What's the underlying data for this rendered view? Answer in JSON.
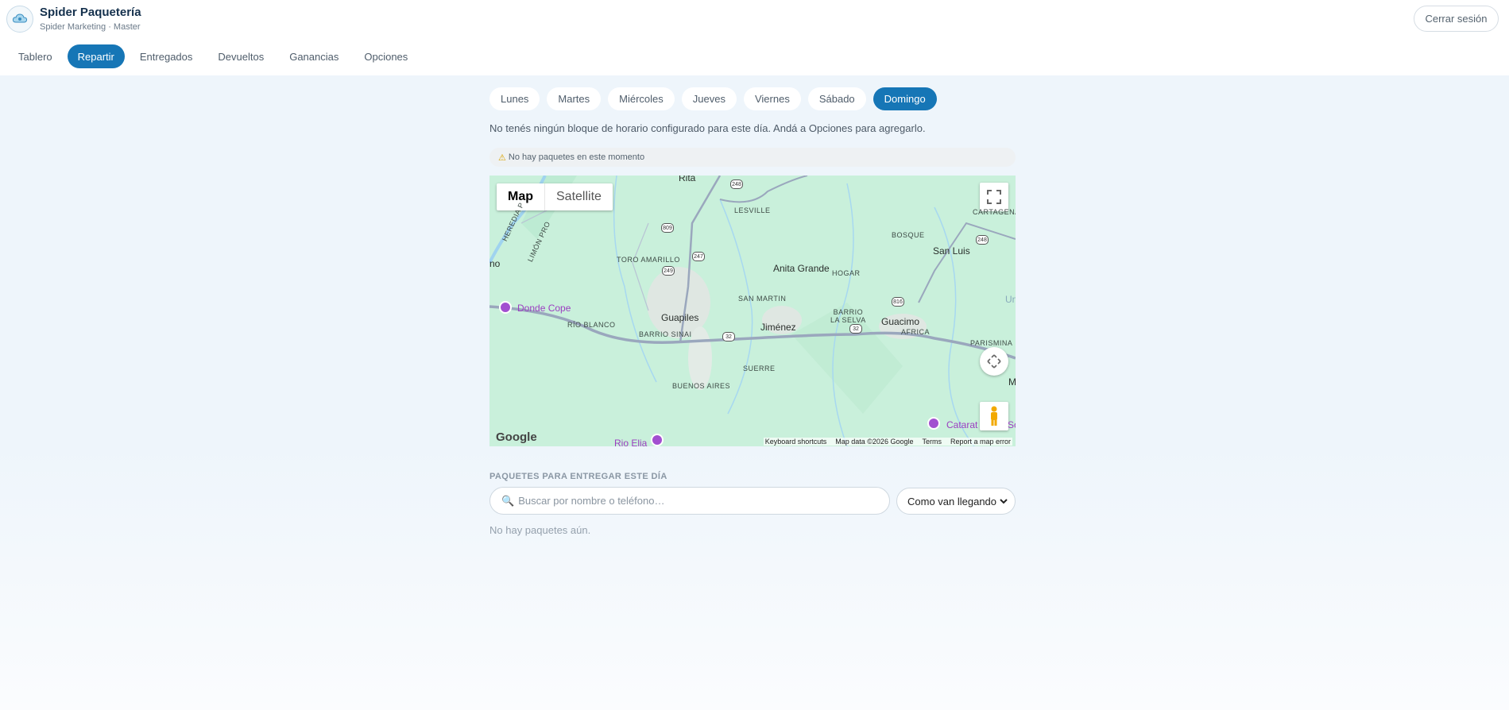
{
  "brand": {
    "title": "Spider Paquetería",
    "subtitle": "Spider Marketing · Master"
  },
  "header": {
    "logout_label": "Cerrar sesión"
  },
  "nav": {
    "items": [
      {
        "label": "Tablero",
        "active": false
      },
      {
        "label": "Repartir",
        "active": true
      },
      {
        "label": "Entregados",
        "active": false
      },
      {
        "label": "Devueltos",
        "active": false
      },
      {
        "label": "Ganancias",
        "active": false
      },
      {
        "label": "Opciones",
        "active": false
      }
    ]
  },
  "days": {
    "items": [
      {
        "label": "Lunes",
        "active": false
      },
      {
        "label": "Martes",
        "active": false
      },
      {
        "label": "Miércoles",
        "active": false
      },
      {
        "label": "Jueves",
        "active": false
      },
      {
        "label": "Viernes",
        "active": false
      },
      {
        "label": "Sábado",
        "active": false
      },
      {
        "label": "Domingo",
        "active": true
      }
    ]
  },
  "schedule_notice": "No tenés ningún bloque de horario configurado para este día. Andá a Opciones para agregarlo.",
  "alert": {
    "icon": "warning-icon",
    "text": "No hay paquetes en este momento"
  },
  "map": {
    "type_buttons": {
      "map": "Map",
      "satellite": "Satellite"
    },
    "labels": {
      "town_guapiles": "Guapiles",
      "town_jimenez": "Jiménez",
      "town_guacimo": "Guacimo",
      "town_anita": "Anita Grande",
      "town_sanluis": "San Luis",
      "poi_donde": "Donde Cope",
      "poi_rio": "Rio Elia",
      "poi_catarat": "Catarat",
      "poi_so": "So",
      "lesville": "LESVILLE",
      "bosque": "BOSQUE",
      "cartagena": "CARTAGENA",
      "toro": "TORO AMARILLO",
      "hogar": "HOGAR",
      "sanmartin": "SAN MARTIN",
      "barrio_selva": "BARRIO\nLA SELVA",
      "africa": "AFRICA",
      "rioblanco": "RÍO BLANCO",
      "barriosinai": "BARRIO SINAI",
      "parismina": "PARISMINA",
      "suerre": "SUERRE",
      "buenosaires": "BUENOS AIRES",
      "heredia": "HEREDIA P",
      "limon": "LIMÓN PRO",
      "edge_no": "no",
      "edge_un": "Un",
      "edge_m": "M",
      "edge_rita": "Rita",
      "r248a": "248",
      "r809": "809",
      "r247": "247",
      "r249": "249",
      "r248b": "248",
      "r816": "816",
      "r32a": "32",
      "r32b": "32"
    },
    "google": "Google",
    "attribution": [
      "Keyboard shortcuts",
      "Map data ©2026 Google",
      "Terms",
      "Report a map error"
    ]
  },
  "packages": {
    "section_title": "PAQUETES PARA ENTREGAR ESTE DÍA",
    "search_placeholder": "Buscar por nombre o teléfono…",
    "sort_selected": "Como van llegando",
    "empty_text": "No hay paquetes aún."
  },
  "colors": {
    "accent": "#1676b6",
    "map_land": "#c9f0db"
  }
}
